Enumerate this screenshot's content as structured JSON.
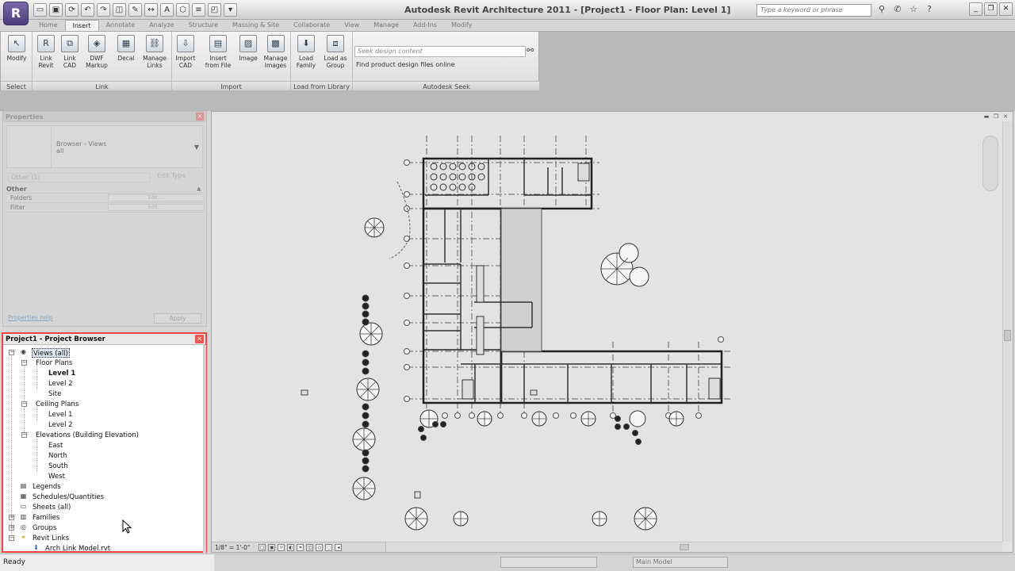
{
  "app": {
    "title": "Autodesk Revit Architecture 2011 - [Project1 - Floor Plan: Level 1]",
    "logo_letter": "R",
    "search_placeholder": "Type a keyword or phrase",
    "status": "Ready"
  },
  "ribbon": {
    "tabs": [
      "Home",
      "Insert",
      "Annotate",
      "Analyze",
      "Structure",
      "Massing & Site",
      "Collaborate",
      "View",
      "Manage",
      "Add-Ins",
      "Modify"
    ],
    "active_tab": "Insert",
    "panels": {
      "select": "Select",
      "link": "Link",
      "import": "Import",
      "load_from_library": "Load from Library",
      "autodesk_seek": "Autodesk Seek"
    },
    "buttons": {
      "modify": "Modify",
      "link_revit": "Link Revit",
      "link_cad": "Link CAD",
      "dwf_markup": "DWF Markup",
      "decal": "Decal",
      "manage_links": "Manage Links",
      "import_cad": "Import CAD",
      "insert_from_file": "Insert from File",
      "image": "Image",
      "manage_images": "Manage Images",
      "load_family": "Load Family",
      "load_as_group": "Load as Group"
    },
    "seek": {
      "placeholder": "Seek design content",
      "link": "Find product design files online"
    }
  },
  "properties": {
    "header": "Properties",
    "type_line1": "Browser - Views",
    "type_line2": "all",
    "filter": "Other (1)",
    "edit_type": "Edit Type",
    "category": "Other",
    "rows": [
      {
        "label": "Folders",
        "value": "Edit..."
      },
      {
        "label": "Filter",
        "value": "Edit..."
      }
    ],
    "help_link": "Properties help",
    "apply": "Apply"
  },
  "project_browser": {
    "header": "Project1 - Project Browser",
    "views_all": "Views (all)",
    "floor_plans": "Floor Plans",
    "level1": "Level 1",
    "level2": "Level 2",
    "site": "Site",
    "ceiling_plans": "Ceiling Plans",
    "c_level1": "Level 1",
    "c_level2": "Level 2",
    "elevations": "Elevations (Building Elevation)",
    "east": "East",
    "north": "North",
    "south": "South",
    "west": "West",
    "legends": "Legends",
    "schedules": "Schedules/Quantities",
    "sheets": "Sheets (all)",
    "families": "Families",
    "groups": "Groups",
    "revit_links": "Revit Links",
    "arch_link": "Arch Link Model.rvt"
  },
  "view": {
    "scale": "1/8\" = 1'-0\""
  },
  "statusbar": {
    "workset": "Main Model"
  }
}
